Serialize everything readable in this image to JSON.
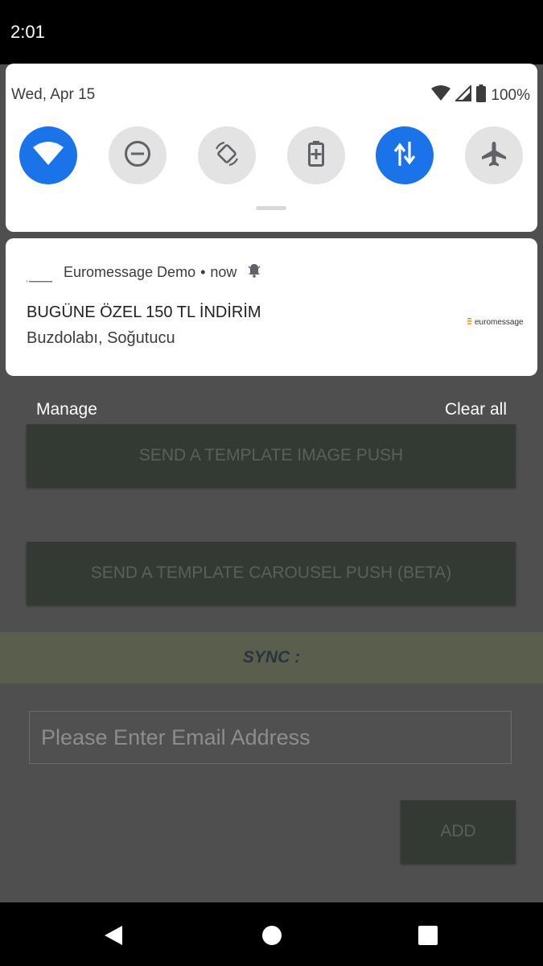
{
  "status_bar": {
    "time": "2:01"
  },
  "quick_settings": {
    "date": "Wed, Apr 15",
    "battery": "100%",
    "tiles": [
      {
        "name": "wifi",
        "on": true
      },
      {
        "name": "do-not-disturb",
        "on": false
      },
      {
        "name": "auto-rotate",
        "on": false
      },
      {
        "name": "battery-saver",
        "on": false
      },
      {
        "name": "mobile-data",
        "on": true
      },
      {
        "name": "airplane-mode",
        "on": false
      }
    ]
  },
  "notification": {
    "app_name": "Euromessage Demo",
    "time": "now",
    "title": "BUGÜNE ÖZEL 150 TL İNDİRİM",
    "body": "Buzdolabı, Soğutucu",
    "logo_text": "euromessage"
  },
  "shade_actions": {
    "manage": "Manage",
    "clear_all": "Clear all"
  },
  "app": {
    "image_push_button": "SEND A TEMPLATE IMAGE PUSH",
    "carousel_push_button": "SEND A TEMPLATE CAROUSEL PUSH (BETA)",
    "sync_label": "SYNC :",
    "email_placeholder": "Please Enter Email Address",
    "add_button": "ADD"
  },
  "colors": {
    "accent": "#1a73e8",
    "logo_orange": "#f29100"
  }
}
